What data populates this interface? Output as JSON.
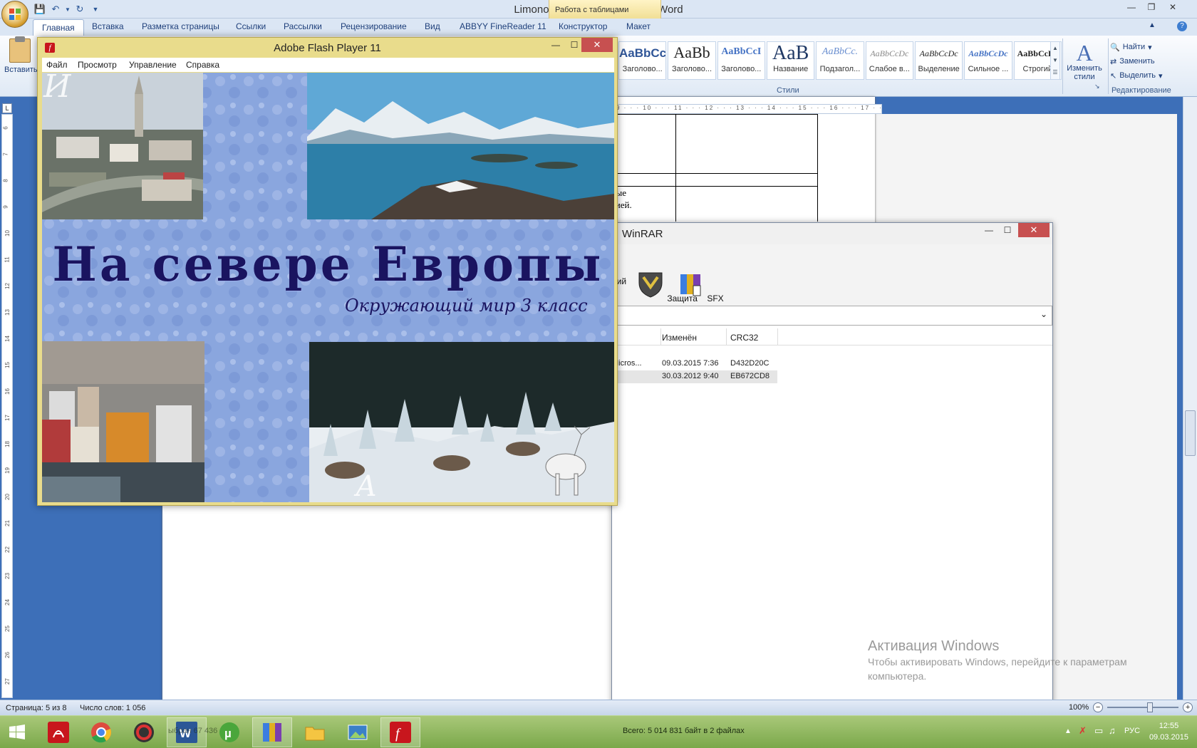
{
  "word": {
    "title": "LimonovaOA_yrok - Microsoft Word",
    "context_tab": "Работа с таблицами",
    "tabs": [
      "Главная",
      "Вставка",
      "Разметка страницы",
      "Ссылки",
      "Рассылки",
      "Рецензирование",
      "Вид",
      "ABBYY FineReader 11",
      "Конструктор",
      "Макет"
    ],
    "paste_label": "Вставить",
    "styles": [
      {
        "preview": "AaBbCc",
        "name": "Заголово..."
      },
      {
        "preview": "AaBb",
        "name": "Заголово..."
      },
      {
        "preview": "AaBbCcI",
        "name": "Заголово..."
      },
      {
        "preview": "AaB",
        "name": "Название"
      },
      {
        "preview": "AaBbCc.",
        "name": "Подзагол..."
      },
      {
        "preview": "AaBbCcDc",
        "name": "Слабое в..."
      },
      {
        "preview": "AaBbCcDc",
        "name": "Выделение"
      },
      {
        "preview": "AaBbCcDc",
        "name": "Сильное ..."
      },
      {
        "preview": "AaBbCcDc",
        "name": "Строгий"
      }
    ],
    "styles_group": "Стили",
    "change_styles": "Изменить стили",
    "editing": {
      "find": "Найти",
      "replace": "Заменить",
      "select": "Выделить",
      "group": "Редактирование"
    },
    "ruler_h": "9 · · · 10 · · · 11 · · · 12 · · · 13 · · · 14 · · · 15 · · · 16 · · · 17 · · · 18",
    "ruler_v": [
      "6",
      "7",
      "8",
      "9",
      "10",
      "11",
      "12",
      "13",
      "14",
      "15",
      "16",
      "17",
      "18",
      "19",
      "20",
      "21",
      "22",
      "23",
      "24",
      "25",
      "26",
      "27"
    ],
    "doc_text": [
      "рые",
      "сией."
    ],
    "status": {
      "page": "Страница: 5 из 8",
      "words": "Число слов: 1 056",
      "zoom": "100%"
    }
  },
  "winrar": {
    "title": "WinRAR",
    "toolbar": [
      {
        "label": "рий"
      },
      {
        "label": "Защита"
      },
      {
        "label": "SFX"
      }
    ],
    "columns": {
      "modified": "Изменён",
      "crc": "CRC32"
    },
    "files": [
      {
        "name": "Micros...",
        "modified": "09.03.2015 7:36",
        "crc": "D432D20C",
        "selected": false
      },
      {
        "name": "e",
        "modified": "30.03.2012 9:40",
        "crc": "EB672CD8",
        "selected": true
      }
    ],
    "summary": "Всего: 5 014 831 байт в 2 файлах"
  },
  "flash": {
    "title": "Adobe Flash Player 11",
    "menu": [
      "Файл",
      "Просмотр",
      "Управление",
      "Справка"
    ],
    "stage_title": "На  севере  Европы",
    "stage_subtitle": "Окружающий мир 3 класс",
    "letter_u": "И",
    "letter_a": "А"
  },
  "activation": {
    "heading": "Активация Windows",
    "text": "Чтобы активировать Windows, перейдите к параметрам компьютера."
  },
  "taskbar": {
    "items": [
      "start-icon",
      "acrobat-icon",
      "chrome-icon",
      "media-icon",
      "word-icon",
      "utorrent-icon",
      "winrar-icon",
      "explorer-icon",
      "image-viewer-icon",
      "flash-icon"
    ],
    "ghost": "ыбран   67 436",
    "lang": "РУС",
    "time": "12:55",
    "date": "09.03.2015"
  },
  "colors": {
    "flash_frame": "#e9dc8c",
    "ribbon": "#dbe6f4",
    "taskbar": "#8ab55a",
    "close": "#c75050"
  }
}
